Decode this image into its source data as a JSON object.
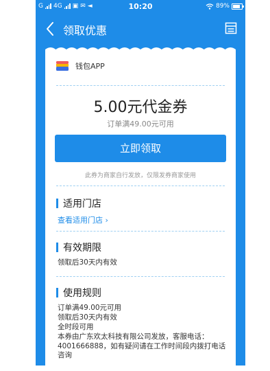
{
  "status_bar": {
    "carrier_left": "G",
    "carrier_mid": "4G",
    "time": "10:20",
    "battery_pct": "89%"
  },
  "header": {
    "back_icon": "chevron-left-icon",
    "title": "领取优惠",
    "menu_icon": "list-icon"
  },
  "coupon": {
    "app_name": "钱包APP",
    "amount": "5.00元代金券",
    "condition": "订单满49.00元可用",
    "claim_button": "立即领取",
    "issuer_note": "此券为商家自行发放，仅限发券商家使用"
  },
  "stores": {
    "title": "适用门店",
    "link": "查看适用门店 ›"
  },
  "validity": {
    "title": "有效期限",
    "text": "领取后30天内有效"
  },
  "rules": {
    "title": "使用规则",
    "lines": [
      "订单满49.00元可用",
      "领取后30天内有效",
      "全时段可用",
      "本券由广东欢太科技有限公司发放，客服电话：4001666888，如有疑问请在工作时间段内拨打电话咨询"
    ]
  },
  "colors": {
    "brand_blue": "#1e8ce8",
    "card_bg": "#ffffff"
  }
}
